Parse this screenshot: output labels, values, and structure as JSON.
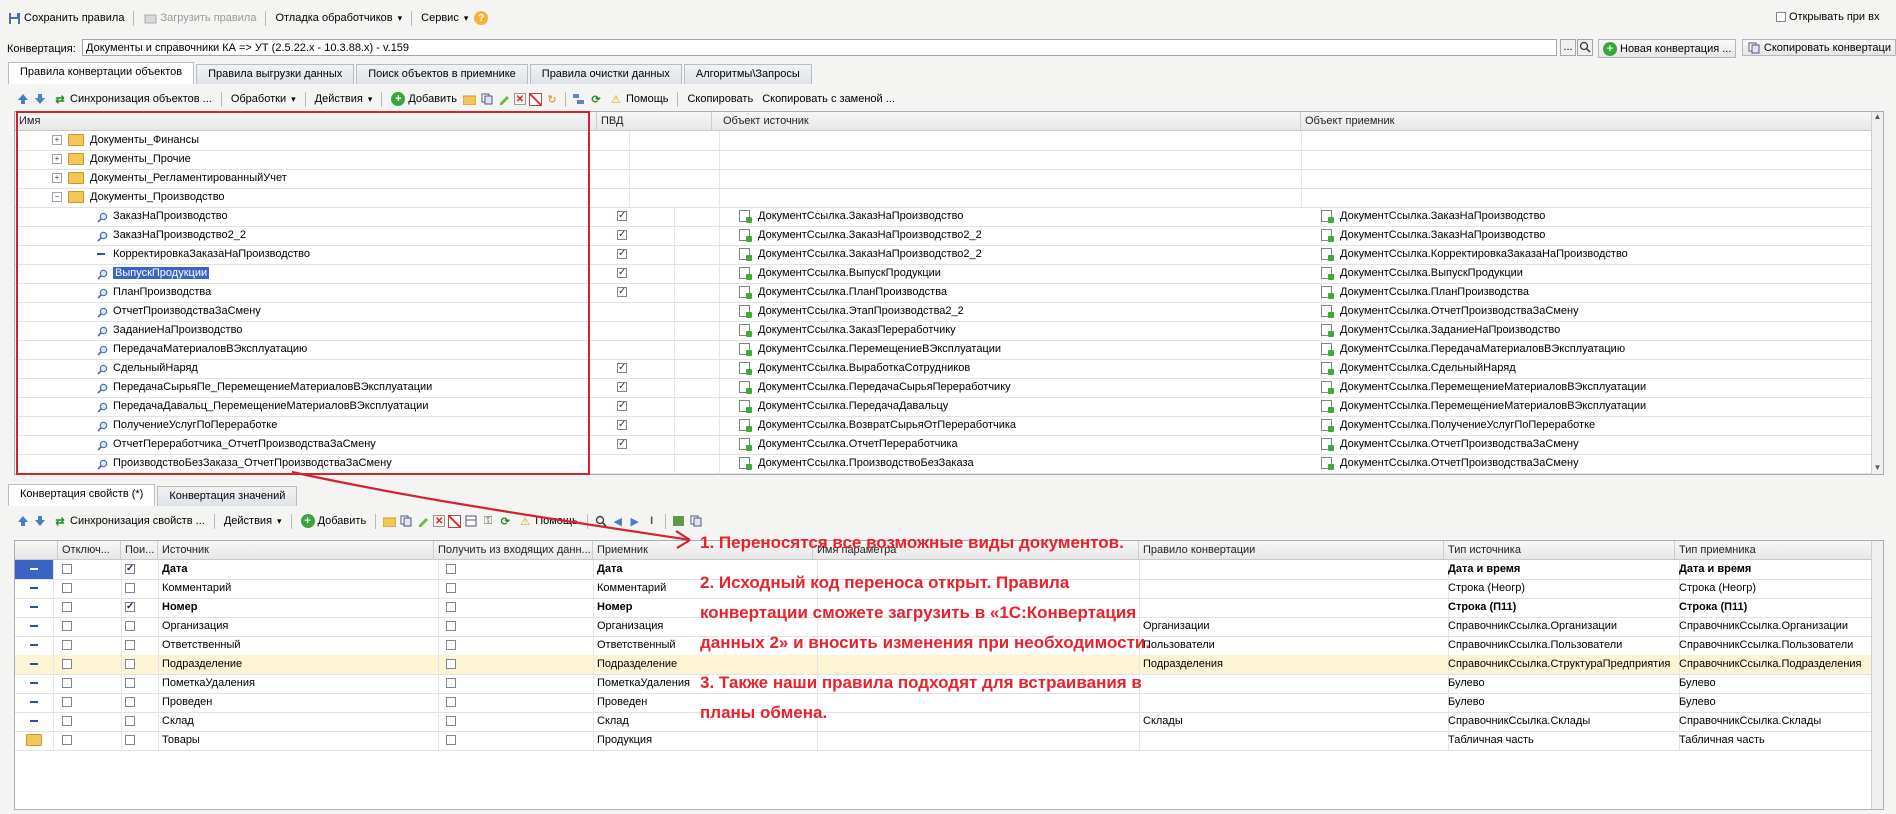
{
  "top_toolbar": {
    "save_rules": "Сохранить правила",
    "load_rules": "Загрузить правила",
    "debug_handlers": "Отладка обработчиков",
    "service": "Сервис",
    "help_q": "?",
    "open_on": "Открывать при вх"
  },
  "conversion_bar": {
    "label": "Конвертация:",
    "value": "Документы и справочники КА => УТ (2.5.22.х - 10.3.88.х) - v.159",
    "dots": "...",
    "new_conversion": "Новая конвертация ...",
    "copy_conversion": "Скопировать конвертаци"
  },
  "main_tabs": [
    "Правила конвертации объектов",
    "Правила выгрузки данных",
    "Поиск объектов в приемнике",
    "Правила очистки данных",
    "Алгоритмы\\Запросы"
  ],
  "upper_toolbar": {
    "sync": "Синхронизация объектов ...",
    "processing": "Обработки",
    "actions": "Действия",
    "add": "Добавить",
    "help": "Помощь",
    "copy": "Скопировать",
    "copy_replace": "Скопировать с заменой ..."
  },
  "upper_grid": {
    "columns": [
      "Имя",
      "ПВД",
      "Объект источник",
      "Объект приемник"
    ],
    "folders": [
      {
        "name": "Документы_Финансы",
        "expander": "+"
      },
      {
        "name": "Документы_Прочие",
        "expander": "+"
      },
      {
        "name": "Документы_РегламентированныйУчет",
        "expander": "+"
      },
      {
        "name": "Документы_Производство",
        "expander": "−"
      }
    ],
    "rows": [
      {
        "icon": "magnifier-icon",
        "name": "ЗаказНаПроизводство",
        "pvd": true,
        "source": "ДокументСсылка.ЗаказНаПроизводство",
        "target": "ДокументСсылка.ЗаказНаПроизводство"
      },
      {
        "icon": "magnifier-icon",
        "name": "ЗаказНаПроизводство2_2",
        "pvd": true,
        "source": "ДокументСсылка.ЗаказНаПроизводство2_2",
        "target": "ДокументСсылка.ЗаказНаПроизводство"
      },
      {
        "icon": "dash-icon",
        "name": "КорректировкаЗаказаНаПроизводство",
        "pvd": true,
        "source": "ДокументСсылка.ЗаказНаПроизводство2_2",
        "target": "ДокументСсылка.КорректировкаЗаказаНаПроизводство"
      },
      {
        "icon": "magnifier-icon",
        "name": "ВыпускПродукции",
        "pvd": true,
        "source": "ДокументСсылка.ВыпускПродукции",
        "target": "ДокументСсылка.ВыпускПродукции",
        "selected": true
      },
      {
        "icon": "magnifier-icon",
        "name": "ПланПроизводства",
        "pvd": true,
        "source": "ДокументСсылка.ПланПроизводства",
        "target": "ДокументСсылка.ПланПроизводства"
      },
      {
        "icon": "magnifier-icon",
        "name": "ОтчетПроизводстваЗаСмену",
        "pvd": false,
        "source": "ДокументСсылка.ЭтапПроизводства2_2",
        "target": "ДокументСсылка.ОтчетПроизводстваЗаСмену"
      },
      {
        "icon": "magnifier-icon",
        "name": "ЗаданиеНаПроизводство",
        "pvd": false,
        "source": "ДокументСсылка.ЗаказПереработчику",
        "target": "ДокументСсылка.ЗаданиеНаПроизводство"
      },
      {
        "icon": "magnifier-icon",
        "name": "ПередачаМатериаловВЭксплуатацию",
        "pvd": false,
        "source": "ДокументСсылка.ПеремещениеВЭксплуатации",
        "target": "ДокументСсылка.ПередачаМатериаловВЭксплуатацию"
      },
      {
        "icon": "magnifier-icon",
        "name": "СдельныйНаряд",
        "pvd": true,
        "source": "ДокументСсылка.ВыработкаСотрудников",
        "target": "ДокументСсылка.СдельныйНаряд"
      },
      {
        "icon": "magnifier-icon",
        "name": "ПередачаСырьяПе_ПеремещениеМатериаловВЭксплуатации",
        "pvd": true,
        "source": "ДокументСсылка.ПередачаСырьяПереработчику",
        "target": "ДокументСсылка.ПеремещениеМатериаловВЭксплуатации"
      },
      {
        "icon": "magnifier-icon",
        "name": "ПередачаДавальц_ПеремещениеМатериаловВЭксплуатации",
        "pvd": true,
        "source": "ДокументСсылка.ПередачаДавальцу",
        "target": "ДокументСсылка.ПеремещениеМатериаловВЭксплуатации"
      },
      {
        "icon": "magnifier-icon",
        "name": "ПолучениеУслугПоПереработке",
        "pvd": true,
        "source": "ДокументСсылка.ВозвратСырьяОтПереработчика",
        "target": "ДокументСсылка.ПолучениеУслугПоПереработке"
      },
      {
        "icon": "magnifier-icon",
        "name": "ОтчетПереработчика_ОтчетПроизводстваЗаСмену",
        "pvd": true,
        "source": "ДокументСсылка.ОтчетПереработчика",
        "target": "ДокументСсылка.ОтчетПроизводстваЗаСмену"
      },
      {
        "icon": "magnifier-icon",
        "name": "ПроизводствоБезЗаказа_ОтчетПроизводстваЗаСмену",
        "pvd": false,
        "source": "ДокументСсылка.ПроизводствоБезЗаказа",
        "target": "ДокументСсылка.ОтчетПроизводстваЗаСмену"
      }
    ]
  },
  "lower_tabs": [
    "Конвертация свойств (*)",
    "Конвертация значений"
  ],
  "lower_toolbar": {
    "sync": "Синхронизация свойств ...",
    "actions": "Действия",
    "add": "Добавить",
    "help": "Помощь"
  },
  "lower_grid": {
    "columns": [
      "Отключ...",
      "Пои...",
      "Источник",
      "Получить из входящих данн...",
      "Приемник",
      "Имя параметра",
      "Правило конвертации",
      "Тип источника",
      "Тип приемника"
    ],
    "rows": [
      {
        "search": true,
        "source": "Дата",
        "target": "Дата",
        "rule": "",
        "src_type": "Дата и время",
        "dst_type": "Дата и время",
        "bold": true
      },
      {
        "search": false,
        "source": "Комментарий",
        "target": "Комментарий",
        "rule": "",
        "src_type": "Строка (Неогр)",
        "dst_type": "Строка (Неогр)",
        "bold": false
      },
      {
        "search": true,
        "source": "Номер",
        "target": "Номер",
        "rule": "",
        "src_type": "Строка (П11)",
        "dst_type": "Строка (П11)",
        "bold": true
      },
      {
        "search": false,
        "source": "Организация",
        "target": "Организация",
        "rule": "Организации",
        "src_type": "СправочникСсылка.Организации",
        "dst_type": "СправочникСсылка.Организации",
        "bold": false
      },
      {
        "search": false,
        "source": "Ответственный",
        "target": "Ответственный",
        "rule": "Пользователи",
        "src_type": "СправочникСсылка.Пользователи",
        "dst_type": "СправочникСсылка.Пользователи",
        "bold": false
      },
      {
        "search": false,
        "source": "Подразделение",
        "target": "Подразделение",
        "rule": "Подразделения",
        "src_type": "СправочникСсылка.СтруктураПредприятия",
        "dst_type": "СправочникСсылка.Подразделения",
        "bold": false,
        "highlight": true
      },
      {
        "search": false,
        "source": "ПометкаУдаления",
        "target": "ПометкаУдаления",
        "rule": "",
        "src_type": "Булево",
        "dst_type": "Булево",
        "bold": false
      },
      {
        "search": false,
        "source": "Проведен",
        "target": "Проведен",
        "rule": "",
        "src_type": "Булево",
        "dst_type": "Булево",
        "bold": false
      },
      {
        "search": false,
        "source": "Склад",
        "target": "Склад",
        "rule": "Склады",
        "src_type": "СправочникСсылка.Склады",
        "dst_type": "СправочникСсылка.Склады",
        "bold": false
      },
      {
        "search": false,
        "source": "Товары",
        "target": "Продукция",
        "rule": "",
        "src_type": "Табличная часть",
        "dst_type": "Табличная часть",
        "bold": false,
        "folder": true
      }
    ]
  },
  "annotations": {
    "note1": "1. Переносятся все возможные виды документов.",
    "note2_line1": "2. Исходный код переноса открыт. Правила",
    "note2_line2": "конвертации сможете загрузить в «1С:Конвертация",
    "note2_line3": "данных 2» и вносить изменения при необходимости.",
    "note3_line1": "3. Также наши правила подходят для встраивания в",
    "note3_line2": "планы обмена."
  },
  "colors": {
    "annotation_red": "#e8222e",
    "selection_blue": "#3a63c6",
    "row_highlight": "#fdf4d6"
  }
}
